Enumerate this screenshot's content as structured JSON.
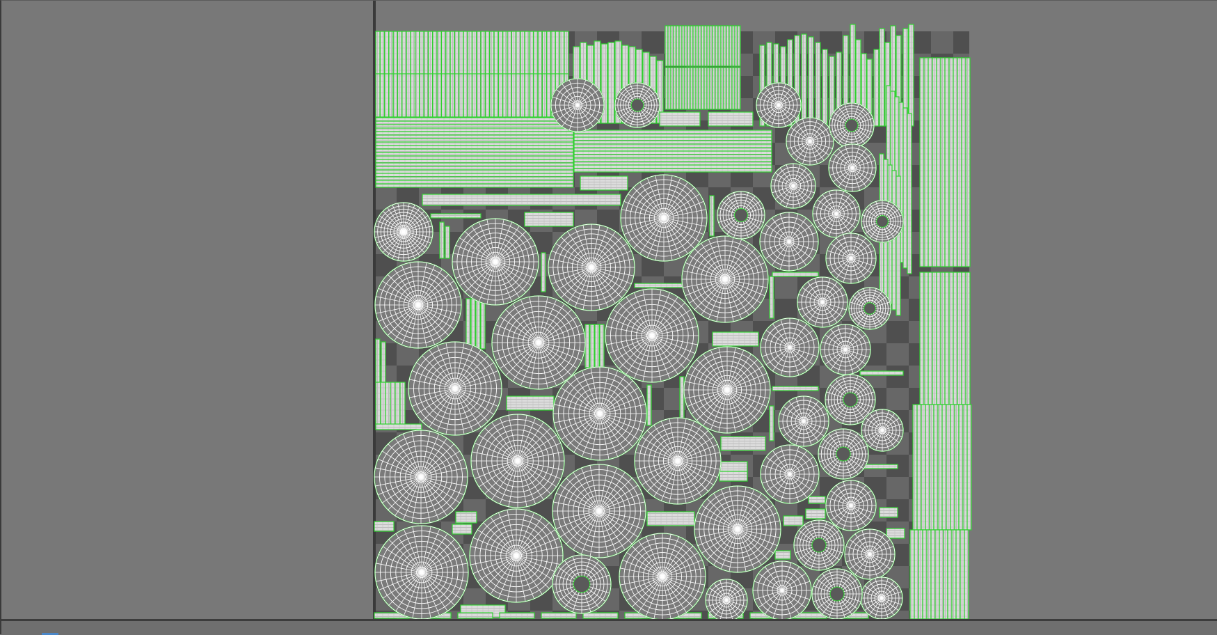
{
  "app": {
    "view_name": "uv-editor-viewport"
  },
  "colors": {
    "background": "#787878",
    "uv_space_dark": "#4f4f4f",
    "uv_space_light": "#6a6a6a",
    "axis_line": "#3a3a3a",
    "island_outline": "#2fd12f",
    "island_fill": "#d8d8d8",
    "wire": "#ffffff",
    "bottom_accent": "#4b87c8"
  },
  "uv_tiles": {
    "grid_cells": 14,
    "checkerboard": true
  },
  "uv_islands": {
    "large_discs": 26,
    "medium_discs": 24,
    "strip_groups": 9,
    "wireframe": true
  }
}
